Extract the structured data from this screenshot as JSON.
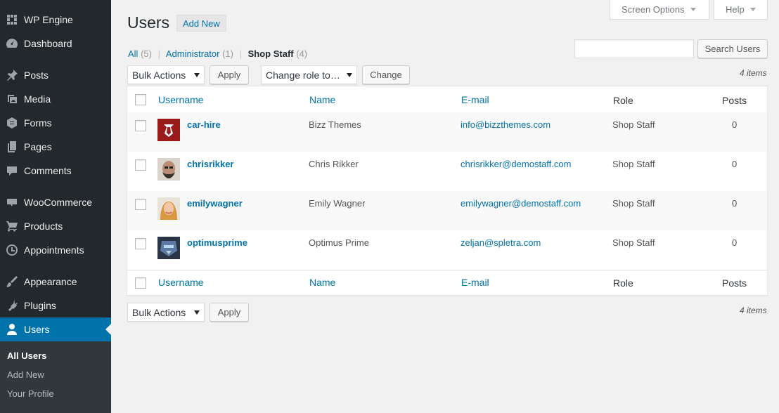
{
  "sidebar": {
    "items": [
      {
        "label": "WP Engine",
        "icon": "wpengine-icon"
      },
      {
        "label": "Dashboard",
        "icon": "dashboard-icon"
      },
      {
        "label": "Posts",
        "icon": "pin-icon"
      },
      {
        "label": "Media",
        "icon": "media-icon"
      },
      {
        "label": "Forms",
        "icon": "forms-icon"
      },
      {
        "label": "Pages",
        "icon": "pages-icon"
      },
      {
        "label": "Comments",
        "icon": "comment-icon"
      },
      {
        "label": "WooCommerce",
        "icon": "woo-icon"
      },
      {
        "label": "Products",
        "icon": "cart-icon"
      },
      {
        "label": "Appointments",
        "icon": "clock-icon"
      },
      {
        "label": "Appearance",
        "icon": "brush-icon"
      },
      {
        "label": "Plugins",
        "icon": "plug-icon"
      },
      {
        "label": "Users",
        "icon": "user-icon"
      }
    ],
    "submenu": [
      "All Users",
      "Add New",
      "Your Profile"
    ]
  },
  "top": {
    "screen_options": "Screen Options",
    "help": "Help"
  },
  "header": {
    "title": "Users",
    "add_new": "Add New"
  },
  "views": {
    "all": "All",
    "all_count": "(5)",
    "admin": "Administrator",
    "admin_count": "(1)",
    "shop": "Shop Staff",
    "shop_count": "(4)"
  },
  "search": {
    "button": "Search Users",
    "value": ""
  },
  "actions": {
    "bulk": "Bulk Actions",
    "apply": "Apply",
    "change_role": "Change role to…",
    "change": "Change",
    "items": "4 items"
  },
  "table": {
    "columns": [
      "Username",
      "Name",
      "E-mail",
      "Role",
      "Posts"
    ],
    "rows": [
      {
        "username": "car-hire",
        "name": "Bizz Themes",
        "email": "info@bizzthemes.com",
        "role": "Shop Staff",
        "posts": "0"
      },
      {
        "username": "chrisrikker",
        "name": "Chris Rikker",
        "email": "chrisrikker@demostaff.com",
        "role": "Shop Staff",
        "posts": "0"
      },
      {
        "username": "emilywagner",
        "name": "Emily Wagner",
        "email": "emilywagner@demostaff.com",
        "role": "Shop Staff",
        "posts": "0"
      },
      {
        "username": "optimusprime",
        "name": "Optimus Prime",
        "email": "zeljan@spletra.com",
        "role": "Shop Staff",
        "posts": "0"
      }
    ]
  },
  "colors": {
    "sidebar": "#23282d",
    "accent": "#0073aa",
    "submenu": "#32373c"
  }
}
